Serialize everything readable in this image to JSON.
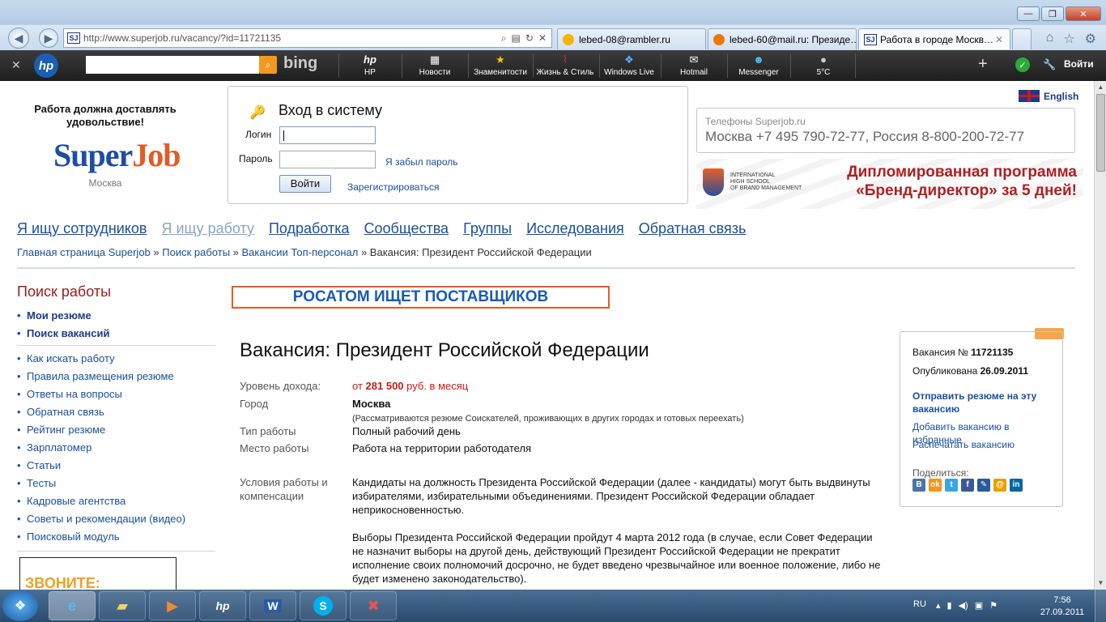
{
  "browser": {
    "url": "http://www.superjob.ru/vacancy/?id=11721135",
    "tabs": [
      {
        "label": "lebed-08@rambler.ru",
        "icon": "rambler-icon",
        "color": "#f5b400"
      },
      {
        "label": "lebed-60@mail.ru: Президе…",
        "icon": "mail-icon",
        "color": "#f07800"
      },
      {
        "label": "Работа в городе Москв…",
        "icon": "superjob-icon",
        "color": "#1a3a8c",
        "active": true
      }
    ],
    "favicon_text": "SJ"
  },
  "hp_toolbar": {
    "search_brand": "bing",
    "items": [
      {
        "label": "HP",
        "icon": "hp-icon",
        "glyph": "hp"
      },
      {
        "label": "Новости",
        "icon": "news-icon",
        "glyph": "▦"
      },
      {
        "label": "Знаменитости",
        "icon": "star-icon",
        "glyph": "★"
      },
      {
        "label": "Жизнь & Стиль",
        "icon": "heels-icon",
        "glyph": "⌇"
      },
      {
        "label": "Windows Live",
        "icon": "windows-icon",
        "glyph": "❖"
      },
      {
        "label": "Hotmail",
        "icon": "envelope-icon",
        "glyph": "✉"
      },
      {
        "label": "Messenger",
        "icon": "messenger-icon",
        "glyph": "☻"
      },
      {
        "label": "5°C",
        "icon": "weather-icon",
        "glyph": "●"
      }
    ],
    "login_label": "Войти"
  },
  "header": {
    "slogan": "Работа должна доставлять удовольствие!",
    "logo_part1": "Super",
    "logo_part2": "Job",
    "city": "Москва",
    "language": "English"
  },
  "login": {
    "title": "Вход в систему",
    "login_label": "Логин",
    "password_label": "Пароль",
    "forgot_link": "Я забыл пароль",
    "submit": "Войти",
    "register_link": "Зарегистрироваться"
  },
  "phones": {
    "title": "Телефоны Superjob.ru",
    "text": "Москва +7 495 790-72-77, Россия 8-800-200-72-77"
  },
  "banner": {
    "school_line1": "INTERNATIONAL",
    "school_line2": "HIGH SCHOOL",
    "school_line3": "OF BRAND MANAGEMENT",
    "promo_line1": "Дипломированная программа",
    "promo_line2": "«Бренд-директор» за 5 дней!"
  },
  "topnav": [
    {
      "label": "Я ищу сотрудников"
    },
    {
      "label": "Я ищу работу",
      "current": true
    },
    {
      "label": "Подработка"
    },
    {
      "label": "Сообщества"
    },
    {
      "label": "Группы"
    },
    {
      "label": "Исследования"
    },
    {
      "label": "Обратная связь"
    }
  ],
  "breadcrumbs": {
    "items": [
      "Главная страница Superjob",
      "Поиск работы",
      "Вакансии Топ-персонал"
    ],
    "separator": " » ",
    "current": "Вакансия: Президент Российской Федерации"
  },
  "sidebar": {
    "title": "Поиск работы",
    "primary": [
      "Мои резюме",
      "Поиск вакансий"
    ],
    "secondary": [
      "Как искать работу",
      "Правила размещения резюме",
      "Ответы на вопросы",
      "Обратная связь",
      "Рейтинг резюме",
      "Зарплатомер",
      "Статьи",
      "Тесты",
      "Кадровые агентства",
      "Советы и рекомендации (видео)",
      "Поисковый модуль"
    ],
    "ad_text": "ЗВОНИТЕ:"
  },
  "main": {
    "promo_banner": "РОСАТОМ ИЩЕТ ПОСТАВЩИКОВ",
    "title": "Вакансия: Президент Российской Федерации",
    "income_label": "Уровень дохода:",
    "income_prefix": "от",
    "income_amount": "281 500",
    "income_suffix": "руб. в месяц",
    "city_label": "Город",
    "city_value": "Москва",
    "city_note": "(Рассматриваются резюме Соискателей, проживающих в других городах и готовых переехать)",
    "work_type_label": "Тип работы",
    "work_type_value": "Полный рабочий день",
    "workplace_label": "Место работы",
    "workplace_value": "Работа на территории работодателя",
    "conditions_label": "Условия работы и компенсации",
    "paragraph1": "Кандидаты на должность Президента Российской Федерации (далее - кандидаты) могут быть выдвинуты избирателями, избирательными объединениями. Президент Российской Федерации обладает неприкосновенностью.",
    "paragraph2": "Выборы Президента Российской Федерации пройдут 4 марта 2012 года (в случае, если Совет Федерации не назначит выборы на другой день, действующий Президент Российской Федерации не прекратит исполнение своих полномочий досрочно, не будет введено чрезвычайное или военное положение, либо не будет изменено законодательство)."
  },
  "info_box": {
    "vacancy_label": "Вакансия №",
    "vacancy_id": "11721135",
    "published_label": "Опубликована",
    "published_date": "26.09.2011",
    "send_resume": "Отправить резюме на эту вакансию",
    "add_favorite": "Добавить вакансию в избранные",
    "print": "Распечатать вакансию",
    "share_label": "Поделиться:",
    "share_icons": [
      {
        "name": "vkontakte-icon",
        "glyph": "В",
        "color": "#4c75a3"
      },
      {
        "name": "odnoklassniki-icon",
        "glyph": "ok",
        "color": "#f7931e"
      },
      {
        "name": "twitter-icon",
        "glyph": "t",
        "color": "#3aa6e0"
      },
      {
        "name": "facebook-icon",
        "glyph": "f",
        "color": "#3b5998"
      },
      {
        "name": "livejournal-icon",
        "glyph": "✎",
        "color": "#2a5a9a"
      },
      {
        "name": "mailru-icon",
        "glyph": "@",
        "color": "#e8a000"
      },
      {
        "name": "linkedin-icon",
        "glyph": "in",
        "color": "#0a66a0"
      }
    ]
  },
  "taskbar": {
    "language": "RU",
    "time": "7:56",
    "date": "27.09.2011"
  }
}
